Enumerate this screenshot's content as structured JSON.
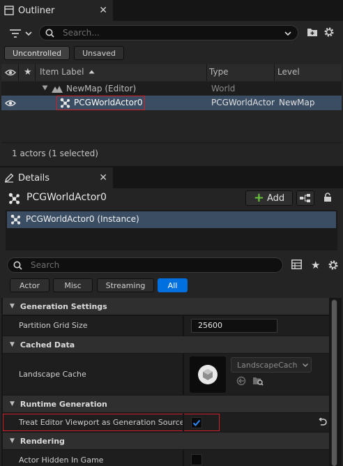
{
  "outliner": {
    "tab_title": "Outliner",
    "search_placeholder": "Search...",
    "filter_uncontrolled": "Uncontrolled",
    "filter_unsaved": "Unsaved",
    "columns": {
      "item_label": "Item Label",
      "type": "Type",
      "level": "Level"
    },
    "rows": [
      {
        "label": "NewMap (Editor)",
        "type": "World",
        "level": ""
      },
      {
        "label": "PCGWorldActor0",
        "type": "PCGWorldActor",
        "level": "NewMap"
      }
    ],
    "status": "1 actors (1 selected)"
  },
  "details": {
    "tab_title": "Details",
    "actor_name": "PCGWorldActor0",
    "add_label": "Add",
    "instance_label": "PCGWorldActor0 (Instance)",
    "search_placeholder": "Search",
    "filters": [
      "Actor",
      "Misc",
      "Streaming",
      "All"
    ],
    "active_filter": "All",
    "categories": {
      "generation_settings": "Generation Settings",
      "cached_data": "Cached Data",
      "runtime_generation": "Runtime Generation",
      "rendering": "Rendering"
    },
    "properties": {
      "partition_grid_size": {
        "label": "Partition Grid Size",
        "value": "25600"
      },
      "landscape_cache": {
        "label": "Landscape Cache",
        "asset": "LandscapeCach"
      },
      "treat_viewport": {
        "label": "Treat Editor Viewport as Generation Source",
        "checked": true
      },
      "actor_hidden": {
        "label": "Actor Hidden In Game",
        "checked": false
      }
    }
  },
  "colors": {
    "accent_blue": "#0070e0",
    "selection_row": "#3a4d63",
    "highlight_red": "#d0202a",
    "add_green": "#6ac33d"
  }
}
